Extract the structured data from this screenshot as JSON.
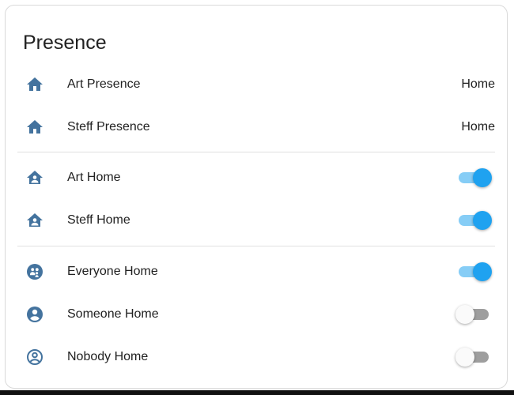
{
  "card": {
    "title": "Presence"
  },
  "colors": {
    "icon": "#44739e",
    "toggle_on": "#1fa2f0",
    "toggle_on_track": "#86cdf6",
    "toggle_off_track": "#9e9e9e"
  },
  "rows": [
    {
      "label": "Art Presence",
      "icon": "home-icon",
      "state": "Home"
    },
    {
      "label": "Steff Presence",
      "icon": "home-icon",
      "state": "Home"
    },
    {
      "label": "Art Home",
      "icon": "home-account-icon",
      "toggle": "on"
    },
    {
      "label": "Steff Home",
      "icon": "home-account-icon",
      "toggle": "on"
    },
    {
      "label": "Everyone Home",
      "icon": "account-group-icon",
      "toggle": "on"
    },
    {
      "label": "Someone Home",
      "icon": "account-circle-icon",
      "toggle": "off"
    },
    {
      "label": "Nobody Home",
      "icon": "account-circle-outline-icon",
      "toggle": "off"
    }
  ]
}
